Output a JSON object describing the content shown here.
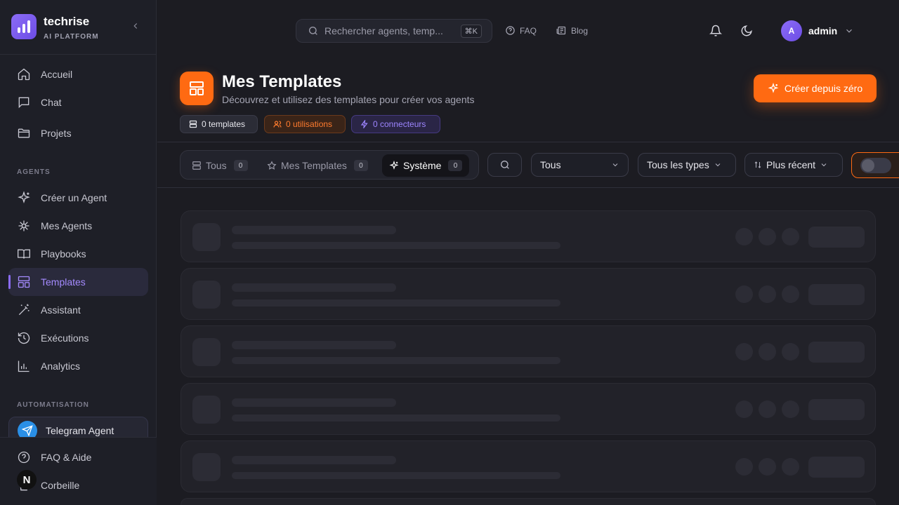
{
  "brand": {
    "name": "techrise",
    "subtitle": "AI PLATFORM"
  },
  "sidebar": {
    "nav": [
      {
        "label": "Accueil",
        "icon": "home-icon"
      },
      {
        "label": "Chat",
        "icon": "chat-icon"
      },
      {
        "label": "Projets",
        "icon": "folder-icon"
      }
    ],
    "agents_label": "AGENTS",
    "agents": [
      {
        "label": "Créer un Agent",
        "icon": "sparkles-icon"
      },
      {
        "label": "Mes Agents",
        "icon": "bot-icon"
      },
      {
        "label": "Playbooks",
        "icon": "book-icon"
      },
      {
        "label": "Templates",
        "icon": "layout-icon",
        "active": true
      },
      {
        "label": "Assistant",
        "icon": "wand-icon"
      },
      {
        "label": "Exécutions",
        "icon": "history-icon"
      },
      {
        "label": "Analytics",
        "icon": "chart-icon"
      }
    ],
    "automation_label": "AUTOMATISATION",
    "telegram": {
      "label": "Telegram Agent",
      "icon": "telegram-icon"
    },
    "bottom": [
      {
        "label": "FAQ & Aide",
        "icon": "help-icon"
      },
      {
        "label": "Corbeille",
        "icon": "trash-icon"
      }
    ],
    "avatar_letter": "N"
  },
  "topbar": {
    "search_placeholder": "Rechercher agents, temp...",
    "shortcut": "⌘K",
    "faq": "FAQ",
    "blog": "Blog",
    "user": {
      "initial": "A",
      "name": "admin"
    }
  },
  "header": {
    "title": "Mes Templates",
    "subtitle": "Découvrez et utilisez des templates pour créer vos agents",
    "stats": {
      "templates": "0 templates",
      "uses": "0 utilisations",
      "connectors": "0 connecteurs"
    },
    "create_button": "Créer depuis zéro"
  },
  "filters": {
    "tabs": [
      {
        "label": "Tous",
        "count": "0"
      },
      {
        "label": "Mes Templates",
        "count": "0"
      },
      {
        "label": "Système",
        "count": "0",
        "active": true
      }
    ],
    "category": "Tous",
    "types": "Tous les types",
    "sort": "Plus récent"
  },
  "colors": {
    "accent": "#ff6a12",
    "brand": "#8b6cf6",
    "background": "#1c1c22"
  },
  "loading_rows": 5
}
